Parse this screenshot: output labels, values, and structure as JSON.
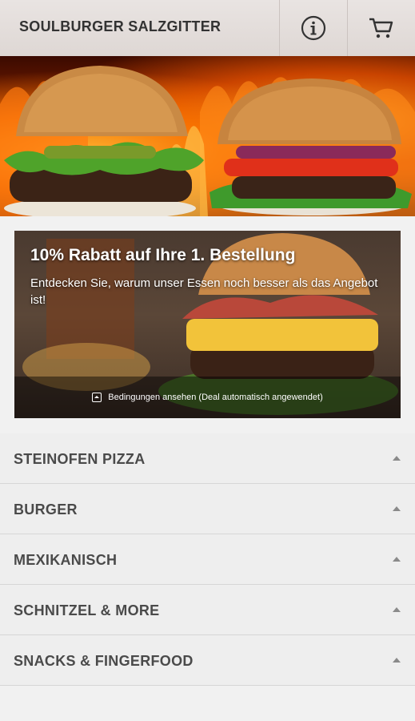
{
  "header": {
    "title": "SOULBURGER SALZGITTER",
    "info_icon": "info-icon",
    "cart_icon": "cart-icon"
  },
  "promo": {
    "title": "10% Rabatt auf Ihre 1. Bestellung",
    "subtitle": "Entdecken Sie, warum unser Essen noch besser als das Angebot ist!",
    "terms_label": "Bedingungen ansehen (Deal automatisch angewendet)"
  },
  "categories": [
    {
      "label": "STEINOFEN PIZZA"
    },
    {
      "label": "BURGER"
    },
    {
      "label": "MEXIKANISCH"
    },
    {
      "label": "SCHNITZEL & MORE"
    },
    {
      "label": "SNACKS & FINGERFOOD"
    }
  ],
  "colors": {
    "header_bg": "#e6e0de",
    "text_dark": "#333333",
    "category_text": "#4a4a4a",
    "category_bg": "#eeeeee"
  }
}
